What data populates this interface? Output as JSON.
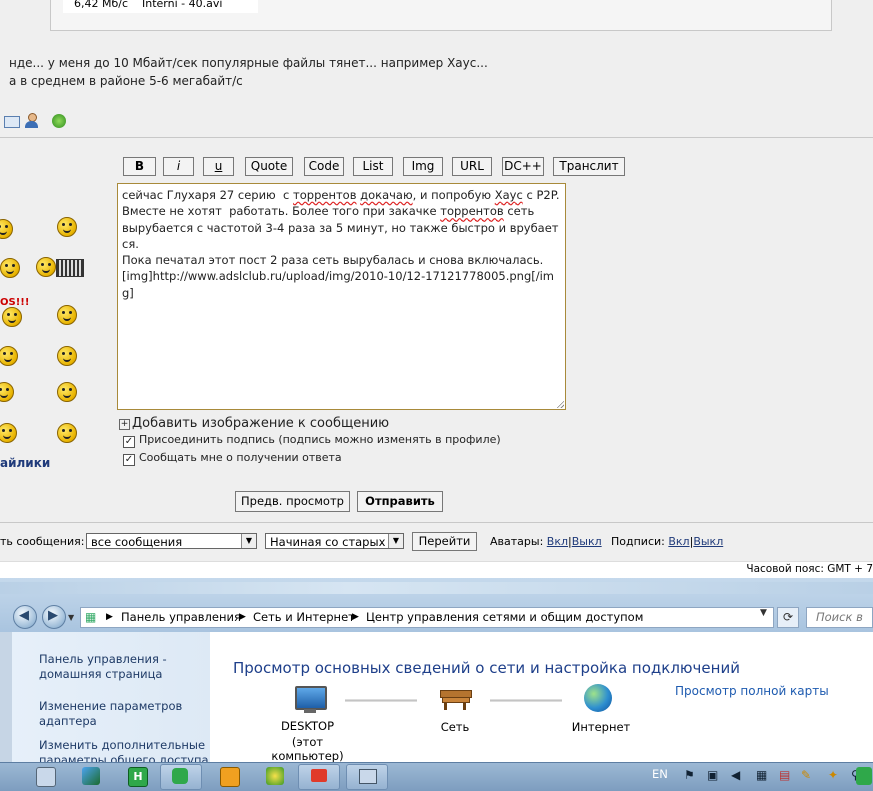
{
  "quote": {
    "rate": "6,42 Мб/с",
    "file": "Interni - 40.avi"
  },
  "post": {
    "line1": "нде... у меня до 10 Мбайт/сек популярные файлы тянет... например Хаус...",
    "line2": "а в среднем в районе 5-6 мегабайт/с"
  },
  "toolbar": {
    "bold": "B",
    "italic": "i",
    "underline": "u",
    "quote": "Quote",
    "code": "Code",
    "list": "List",
    "img": "Img",
    "url": "URL",
    "dc": "DC++",
    "translit": "Транслит"
  },
  "editor": {
    "line1a": "сейчас Глухаря 27 серию  с ",
    "line1_sq1": "торрентов",
    "line1b": " ",
    "line1_sq2": "докачаю",
    "line1c": ", и попробую ",
    "line1_sq3": "Хаус",
    "line1d": " с P2P.",
    "line2": "Вместе не хотят  работать. Более того при закачке ",
    "line2_sq": "торрентов",
    "line2b": " сеть",
    "line3": "вырубается с частотой 3-4 раза за 5 минут, но также быстро и врубается.",
    "line4": "Пока печатал этот пост 2 раза сеть вырубалась и снова включалась.",
    "line5": "[img]http://www.adslclub.ru/upload/img/2010-10/12-17121778005.png[/img]"
  },
  "smilies": {
    "label": "айлики",
    "ooo": "OS!!!"
  },
  "form": {
    "add_image": "Добавить изображение к сообщению",
    "attach_signature": "Присоединить подпись (подпись можно изменять в профиле)",
    "notify_reply": "Сообщать мне о получении ответа",
    "preview": "Предв. просмотр",
    "submit": "Отправить"
  },
  "view_options": {
    "label": "ть сообщения:",
    "filter_value": "все сообщения",
    "order_value": "Начиная со старых",
    "go": "Перейти",
    "avatars_label": "Аватары:",
    "on": "Вкл",
    "sep": "|",
    "off": "Выкл",
    "signatures_label": "Подписи:",
    "timezone": "Часовой пояс: GMT + 7"
  },
  "explorer": {
    "breadcrumb": [
      "Панель управления",
      "Сеть и Интернет",
      "Центр управления сетями и общим доступом"
    ],
    "search_placeholder": "Поиск в",
    "nav": {
      "home": "Панель управления -",
      "home2": "домашняя страница",
      "adapter": "Изменение параметров",
      "adapter2": "адаптера",
      "sharing": "Изменить дополнительные",
      "sharing2": "параметры общего доступа"
    },
    "title": "Просмотр основных сведений о сети и настройка подключений",
    "full_map": "Просмотр полной карты",
    "computer": "DESKTOP",
    "computer_sub": "(этот компьютер)",
    "network": "Сеть",
    "internet": "Интернет"
  },
  "taskbar": {
    "lang": "EN"
  },
  "colors": {
    "link": "#1F3A7A",
    "title_blue": "#1E3F8A",
    "forum_bg": "#EFEFEF"
  }
}
